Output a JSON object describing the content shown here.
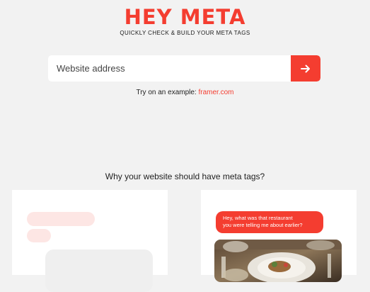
{
  "header": {
    "logo": "HEY META",
    "tagline": "QUICKLY CHECK & BUILD YOUR META TAGS"
  },
  "search": {
    "placeholder": "Website address",
    "submit_icon": "arrow-right-icon"
  },
  "example": {
    "prefix": "Try on an example: ",
    "link": "framer.com"
  },
  "section": {
    "heading": "Why your website should have meta tags?"
  },
  "chat": {
    "line1": "Hey, what was that restaurant",
    "line2": "you were telling me about earlier?"
  },
  "colors": {
    "accent": "#f43d30",
    "background": "#f2f2f2",
    "pill": "#fde6e4"
  }
}
